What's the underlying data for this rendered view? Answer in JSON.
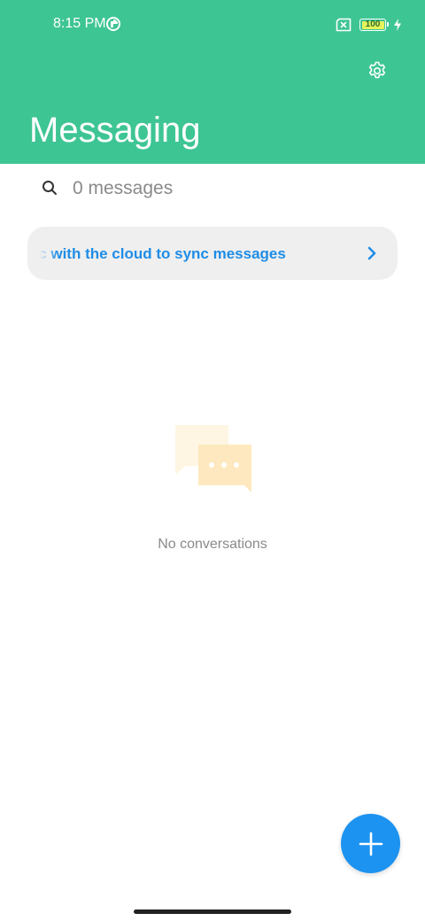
{
  "status_bar": {
    "time": "8:15 PM",
    "battery_level": "100",
    "app_icon": "app-notification-icon",
    "sim_icon": "no-sim-icon",
    "charging_icon": "bolt-icon"
  },
  "header": {
    "title": "Messaging",
    "settings_icon": "gear-icon",
    "background_color": "#3ec594"
  },
  "search": {
    "placeholder": "0 messages",
    "icon": "search-icon"
  },
  "sync_banner": {
    "text": "Sync with the cloud to sync messages",
    "accent_color": "#1f8de6",
    "icon": "chevron-right-icon"
  },
  "empty_state": {
    "message": "No conversations",
    "icon": "chat-bubbles-icon"
  },
  "fab": {
    "icon": "plus-icon",
    "color": "#1c93f0"
  }
}
